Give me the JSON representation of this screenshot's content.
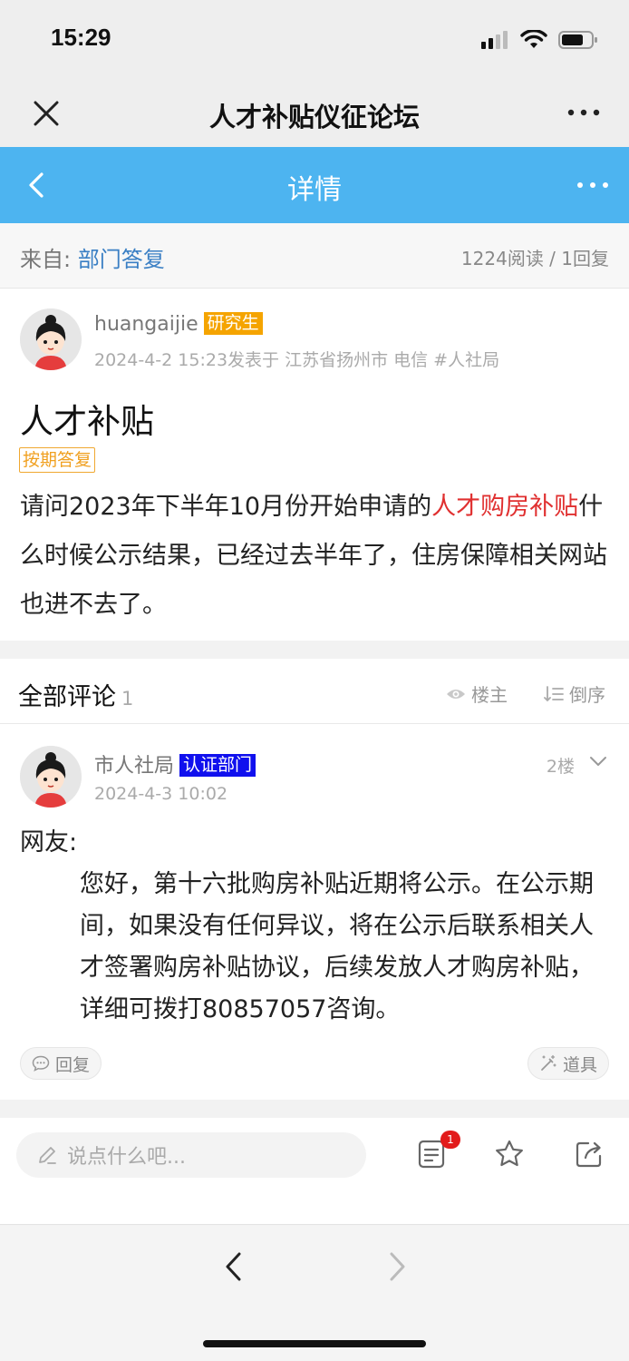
{
  "status": {
    "time": "15:29"
  },
  "app": {
    "title": "人才补贴仪征论坛"
  },
  "nav": {
    "title": "详情"
  },
  "source": {
    "prefix": "来自: ",
    "department": "部门答复",
    "stats": "1224阅读 / 1回复"
  },
  "post": {
    "author": "huangaijie",
    "author_badge": "研究生",
    "meta": "2024-4-2 15:23发表于 江苏省扬州市 电信 #人社局",
    "title": "人才补贴",
    "tag": "按期答复",
    "body_before": "请问2023年下半年10月份开始申请的",
    "body_highlight": "人才购房补贴",
    "body_after": "什么时候公示结果，已经过去半年了，住房保障相关网站也进不去了。"
  },
  "comments": {
    "title": "全部评论",
    "count": "1",
    "filter_owner": "楼主",
    "sort": "倒序",
    "items": [
      {
        "author": "市人社局",
        "badge": "认证部门",
        "time": "2024-4-3 10:02",
        "floor": "2楼",
        "greeting": "网友:",
        "body": "您好，第十六批购房补贴近期将公示。在公示期间，如果没有任何异议，将在公示后联系相关人才签署购房补贴协议，后续发放人才购房补贴，详细可拨打80857057咨询。",
        "reply_label": "回复",
        "props_label": "道具"
      }
    ]
  },
  "compose": {
    "placeholder": "说点什么吧...",
    "unread": "1"
  },
  "colors": {
    "nav_blue": "#4db4f0",
    "highlight_red": "#e03030",
    "badge_orange": "#f5a400",
    "badge_blue": "#1010ee",
    "link_blue": "#3a7fc4"
  }
}
